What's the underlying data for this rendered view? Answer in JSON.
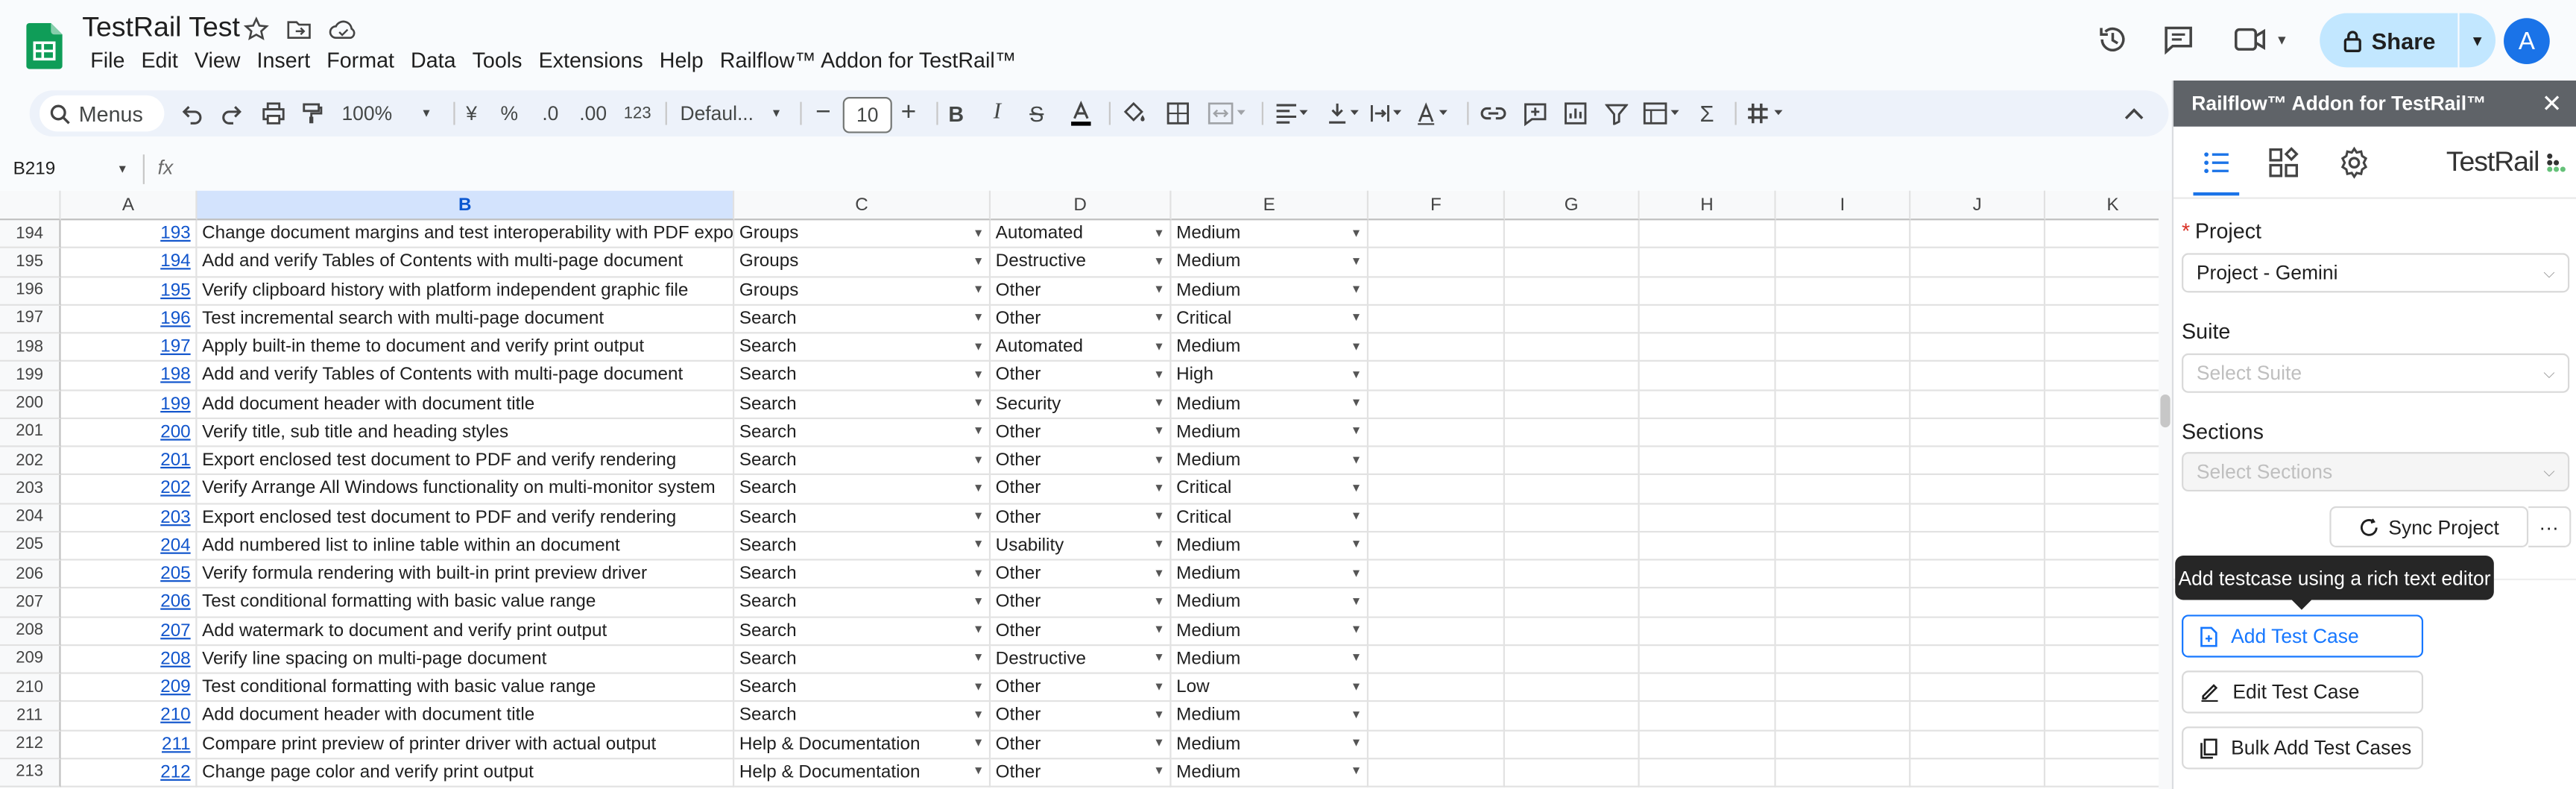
{
  "header": {
    "doc_title": "TestRail Test",
    "menu": [
      "File",
      "Edit",
      "View",
      "Insert",
      "Format",
      "Data",
      "Tools",
      "Extensions",
      "Help",
      "Railflow™ Addon for TestRail™"
    ],
    "share_label": "Share",
    "avatar_letter": "A"
  },
  "toolbar": {
    "menus_label": "Menus",
    "zoom": "100%",
    "currency": "¥",
    "percent": "%",
    "dec_less": ".0",
    "dec_more": ".00",
    "number_format": "123",
    "font": "Defaul...",
    "font_size": "10"
  },
  "formula_bar": {
    "name_box": "B219",
    "fx": "fx"
  },
  "grid": {
    "columns": [
      "A",
      "B",
      "C",
      "D",
      "E",
      "F",
      "G",
      "H",
      "I",
      "J",
      "K"
    ],
    "selected_column": "B",
    "rows": [
      {
        "n": "194",
        "id": "193",
        "title": "Change document margins and test interoperability with PDF export",
        "c": "Groups",
        "d": "Automated",
        "e": "Medium"
      },
      {
        "n": "195",
        "id": "194",
        "title": "Add and verify Tables of Contents with multi-page document",
        "c": "Groups",
        "d": "Destructive",
        "e": "Medium"
      },
      {
        "n": "196",
        "id": "195",
        "title": "Verify clipboard history with platform independent graphic file",
        "c": "Groups",
        "d": "Other",
        "e": "Medium"
      },
      {
        "n": "197",
        "id": "196",
        "title": "Test incremental search with multi-page document",
        "c": "Search",
        "d": "Other",
        "e": "Critical"
      },
      {
        "n": "198",
        "id": "197",
        "title": "Apply built-in theme to document and verify print output",
        "c": "Search",
        "d": "Automated",
        "e": "Medium"
      },
      {
        "n": "199",
        "id": "198",
        "title": "Add and verify Tables of Contents with multi-page document",
        "c": "Search",
        "d": "Other",
        "e": "High"
      },
      {
        "n": "200",
        "id": "199",
        "title": "Add document header with document title",
        "c": "Search",
        "d": "Security",
        "e": "Medium"
      },
      {
        "n": "201",
        "id": "200",
        "title": "Verify title, sub title and heading styles",
        "c": "Search",
        "d": "Other",
        "e": "Medium"
      },
      {
        "n": "202",
        "id": "201",
        "title": "Export enclosed test document to PDF and verify rendering",
        "c": "Search",
        "d": "Other",
        "e": "Medium"
      },
      {
        "n": "203",
        "id": "202",
        "title": "Verify Arrange All Windows functionality on multi-monitor system",
        "c": "Search",
        "d": "Other",
        "e": "Critical"
      },
      {
        "n": "204",
        "id": "203",
        "title": "Export enclosed test document to PDF and verify rendering",
        "c": "Search",
        "d": "Other",
        "e": "Critical"
      },
      {
        "n": "205",
        "id": "204",
        "title": "Add numbered list to inline table within an document",
        "c": "Search",
        "d": "Usability",
        "e": "Medium"
      },
      {
        "n": "206",
        "id": "205",
        "title": "Verify formula rendering with built-in print preview driver",
        "c": "Search",
        "d": "Other",
        "e": "Medium"
      },
      {
        "n": "207",
        "id": "206",
        "title": "Test conditional formatting with basic value range",
        "c": "Search",
        "d": "Other",
        "e": "Medium"
      },
      {
        "n": "208",
        "id": "207",
        "title": "Add watermark to document and verify print output",
        "c": "Search",
        "d": "Other",
        "e": "Medium"
      },
      {
        "n": "209",
        "id": "208",
        "title": "Verify line spacing on multi-page document",
        "c": "Search",
        "d": "Destructive",
        "e": "Medium"
      },
      {
        "n": "210",
        "id": "209",
        "title": "Test conditional formatting with basic value range",
        "c": "Search",
        "d": "Other",
        "e": "Low"
      },
      {
        "n": "211",
        "id": "210",
        "title": "Add document header with document title",
        "c": "Search",
        "d": "Other",
        "e": "Medium"
      },
      {
        "n": "212",
        "id": "211",
        "title": "Compare print preview of printer driver with actual output",
        "c": "Help & Documentation",
        "d": "Other",
        "e": "Medium"
      },
      {
        "n": "213",
        "id": "212",
        "title": "Change page color and verify print output",
        "c": "Help & Documentation",
        "d": "Other",
        "e": "Medium"
      }
    ]
  },
  "panel": {
    "title": "Railflow™ Addon for TestRail™",
    "logo_text": "TestRail",
    "project_label": "Project",
    "project_value": "Project - Gemini",
    "suite_label": "Suite",
    "suite_placeholder": "Select Suite",
    "sections_label": "Sections",
    "sections_placeholder": "Select Sections",
    "sync_label": "Sync Project",
    "more_label": "···",
    "tooltip": "Add testcase using a rich text editor",
    "add_label": "Add Test Case",
    "edit_label": "Edit Test Case",
    "bulk_label": "Bulk Add Test Cases"
  },
  "colors": {
    "sheets_green": "#0f9d58",
    "link_blue": "#1155cc",
    "share_bg": "#c2e7ff",
    "accent": "#1677ff",
    "panel_header": "#5f6368"
  }
}
